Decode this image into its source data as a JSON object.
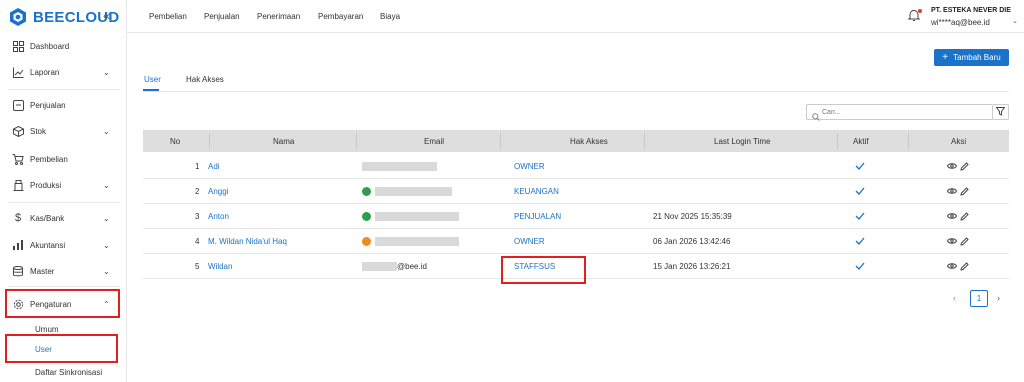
{
  "brand": {
    "name": "BEECLOUD",
    "color": "#1a73c9"
  },
  "sidebar": {
    "items": [
      {
        "label": "Dashboard",
        "icon": "grid-icon"
      },
      {
        "label": "Laporan",
        "icon": "chart-line-icon"
      },
      {
        "label": "Penjualan",
        "icon": "receipt-icon"
      },
      {
        "label": "Stok",
        "icon": "box-icon"
      },
      {
        "label": "Pembelian",
        "icon": "cart-icon"
      },
      {
        "label": "Produksi",
        "icon": "factory-icon"
      },
      {
        "label": "Kas/Bank",
        "icon": "dollar-icon"
      },
      {
        "label": "Akuntansi",
        "icon": "bar-chart-icon"
      },
      {
        "label": "Master",
        "icon": "database-icon"
      },
      {
        "label": "Pengaturan",
        "icon": "gear-icon"
      }
    ],
    "subitems": [
      {
        "label": "Umum"
      },
      {
        "label": "User"
      },
      {
        "label": "Daftar Sinkronisasi"
      }
    ]
  },
  "topnav": [
    "Pembelian",
    "Penjualan",
    "Penerimaan",
    "Pembayaran",
    "Biaya"
  ],
  "account": {
    "company": "PT. ESTEKA NEVER DIE",
    "email": "wi****aq@bee.id"
  },
  "main": {
    "add_button": "Tambah Baru",
    "tabs": [
      "User",
      "Hak Akses"
    ],
    "search_placeholder": "Cari...",
    "columns": [
      "No",
      "Nama",
      "Email",
      "Hak Akses",
      "Last Login Time",
      "Aktif",
      "Aksi"
    ],
    "rows": [
      {
        "no": "1",
        "nama": "Adi",
        "email_suffix": "",
        "avatar": "",
        "hak": "OWNER",
        "login": ""
      },
      {
        "no": "2",
        "nama": "Anggi",
        "email_suffix": "",
        "avatar": "green",
        "hak": "KEUANGAN",
        "login": ""
      },
      {
        "no": "3",
        "nama": "Anton",
        "email_suffix": "",
        "avatar": "green",
        "hak": "PENJUALAN",
        "login": "21 Nov 2025 15:35:39"
      },
      {
        "no": "4",
        "nama": "M. Wildan Nida'ul Haq",
        "email_suffix": "",
        "avatar": "orange",
        "hak": "OWNER",
        "login": "06 Jan 2026 13:42:46"
      },
      {
        "no": "5",
        "nama": "Wildan",
        "email_suffix": "@bee.id",
        "avatar": "",
        "hak": "STAFFSUS",
        "login": "15 Jan 2026 13:26:21"
      }
    ],
    "pagination": {
      "current": "1"
    }
  },
  "colors": {
    "accent": "#1a73c9",
    "highlight": "#e02020",
    "check": "#1a73c9"
  }
}
